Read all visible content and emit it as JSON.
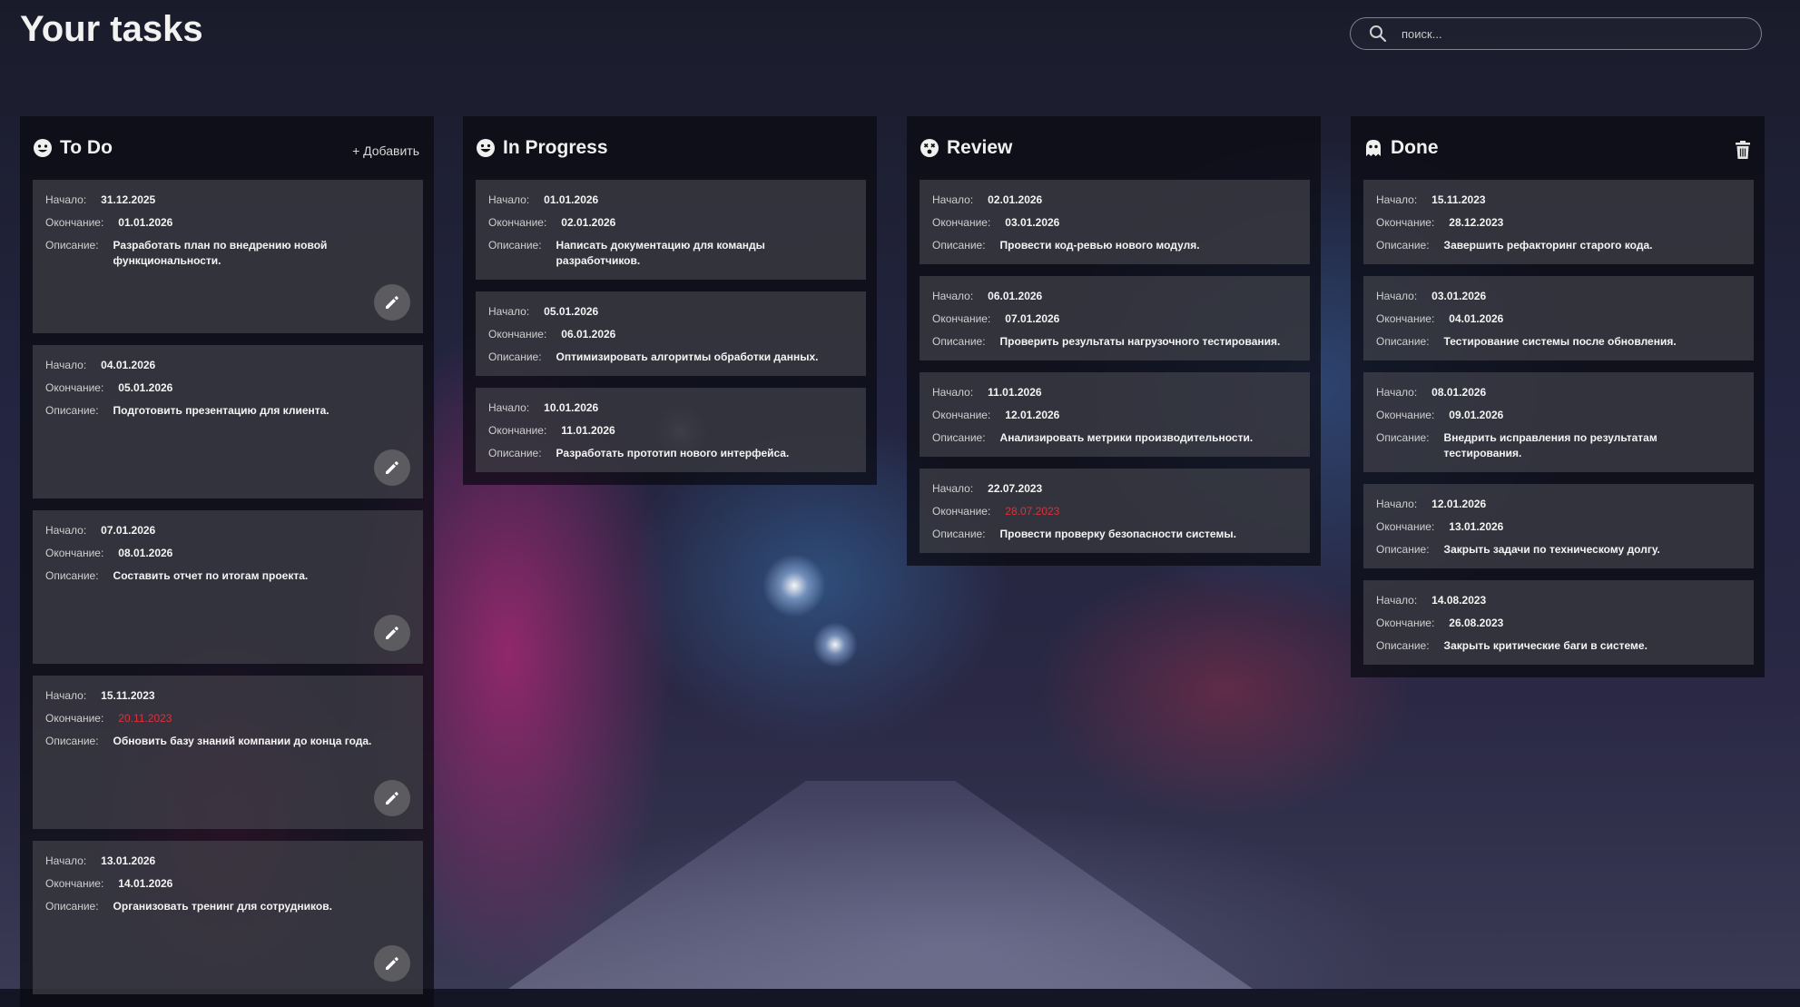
{
  "page": {
    "title": "Your tasks"
  },
  "search": {
    "placeholder": "поиск..."
  },
  "labels": {
    "start": "Начало:",
    "end": "Окончание:",
    "desc": "Описание:"
  },
  "columns": [
    {
      "title": "To Do",
      "icon": "smile-icon",
      "action": "+ Добавить",
      "cards": [
        {
          "start": "31.12.2025",
          "end": "01.01.2026",
          "desc": "Разработать план по внедрению новой функциональности."
        },
        {
          "start": "04.01.2026",
          "end": "05.01.2026",
          "desc": "Подготовить презентацию для клиента."
        },
        {
          "start": "07.01.2026",
          "end": "08.01.2026",
          "desc": "Составить отчет по итогам проекта."
        },
        {
          "start": "15.11.2023",
          "end": "20.11.2023",
          "desc": "Обновить базу знаний компании до конца года.",
          "overdue": true
        },
        {
          "start": "13.01.2026",
          "end": "14.01.2026",
          "desc": "Организовать тренинг для сотрудников."
        }
      ]
    },
    {
      "title": "In Progress",
      "icon": "grin-icon",
      "cards": [
        {
          "start": "01.01.2026",
          "end": "02.01.2026",
          "desc": "Написать документацию для команды разработчиков."
        },
        {
          "start": "05.01.2026",
          "end": "06.01.2026",
          "desc": "Оптимизировать алгоритмы обработки данных."
        },
        {
          "start": "10.01.2026",
          "end": "11.01.2026",
          "desc": "Разработать прототип нового интерфейса."
        }
      ]
    },
    {
      "title": "Review",
      "icon": "dizzy-icon",
      "cards": [
        {
          "start": "02.01.2026",
          "end": "03.01.2026",
          "desc": "Провести код-ревью нового модуля."
        },
        {
          "start": "06.01.2026",
          "end": "07.01.2026",
          "desc": "Проверить результаты нагрузочного тестирования."
        },
        {
          "start": "11.01.2026",
          "end": "12.01.2026",
          "desc": "Анализировать метрики производительности."
        },
        {
          "start": "22.07.2023",
          "end": "28.07.2023",
          "desc": "Провести проверку безопасности системы.",
          "overdue": true
        }
      ]
    },
    {
      "title": "Done",
      "icon": "ghost-icon",
      "action_icon": "trash-icon",
      "cards": [
        {
          "start": "15.11.2023",
          "end": "28.12.2023",
          "desc": "Завершить рефакторинг старого кода."
        },
        {
          "start": "03.01.2026",
          "end": "04.01.2026",
          "desc": "Тестирование системы после обновления."
        },
        {
          "start": "08.01.2026",
          "end": "09.01.2026",
          "desc": "Внедрить исправления по результатам тестирования."
        },
        {
          "start": "12.01.2026",
          "end": "13.01.2026",
          "desc": "Закрыть задачи по техническому долгу."
        },
        {
          "start": "14.08.2023",
          "end": "26.08.2023",
          "desc": "Закрыть критические баги в системе."
        }
      ]
    }
  ],
  "colors": {
    "overdue": "#e0303a",
    "panel": "rgba(10,10,16,0.72)",
    "card": "rgba(72,72,80,0.62)"
  }
}
